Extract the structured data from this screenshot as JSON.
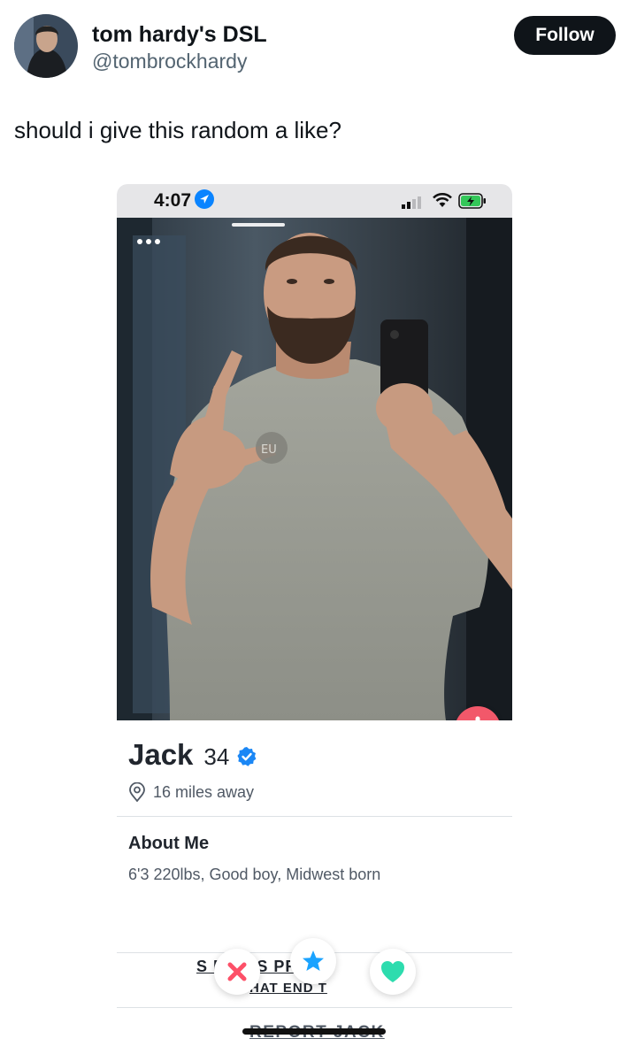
{
  "tweet": {
    "author": {
      "display_name": "tom hardy's DSL",
      "handle": "@tombrockhardy"
    },
    "follow_label": "Follow",
    "text": "should i give this random a like?"
  },
  "embedded_screenshot": {
    "status_bar": {
      "time": "4:07"
    },
    "profile": {
      "name": "Jack",
      "age": "34",
      "distance": "16 miles away",
      "about_title": "About Me",
      "about_text": "6'3 220lbs, Good boy, Midwest born",
      "share_line1": "S  E JA  S PR  E",
      "share_line2": "HAT  END T",
      "report_label": "REPORT JACK"
    },
    "actions": [
      "nope",
      "super-like",
      "like"
    ],
    "colors": {
      "nope": "#fd5068",
      "super_like": "#1aa3ff",
      "like": "#2ddcae",
      "down_button": "#f2586a",
      "verified": "#1b87f5"
    }
  }
}
